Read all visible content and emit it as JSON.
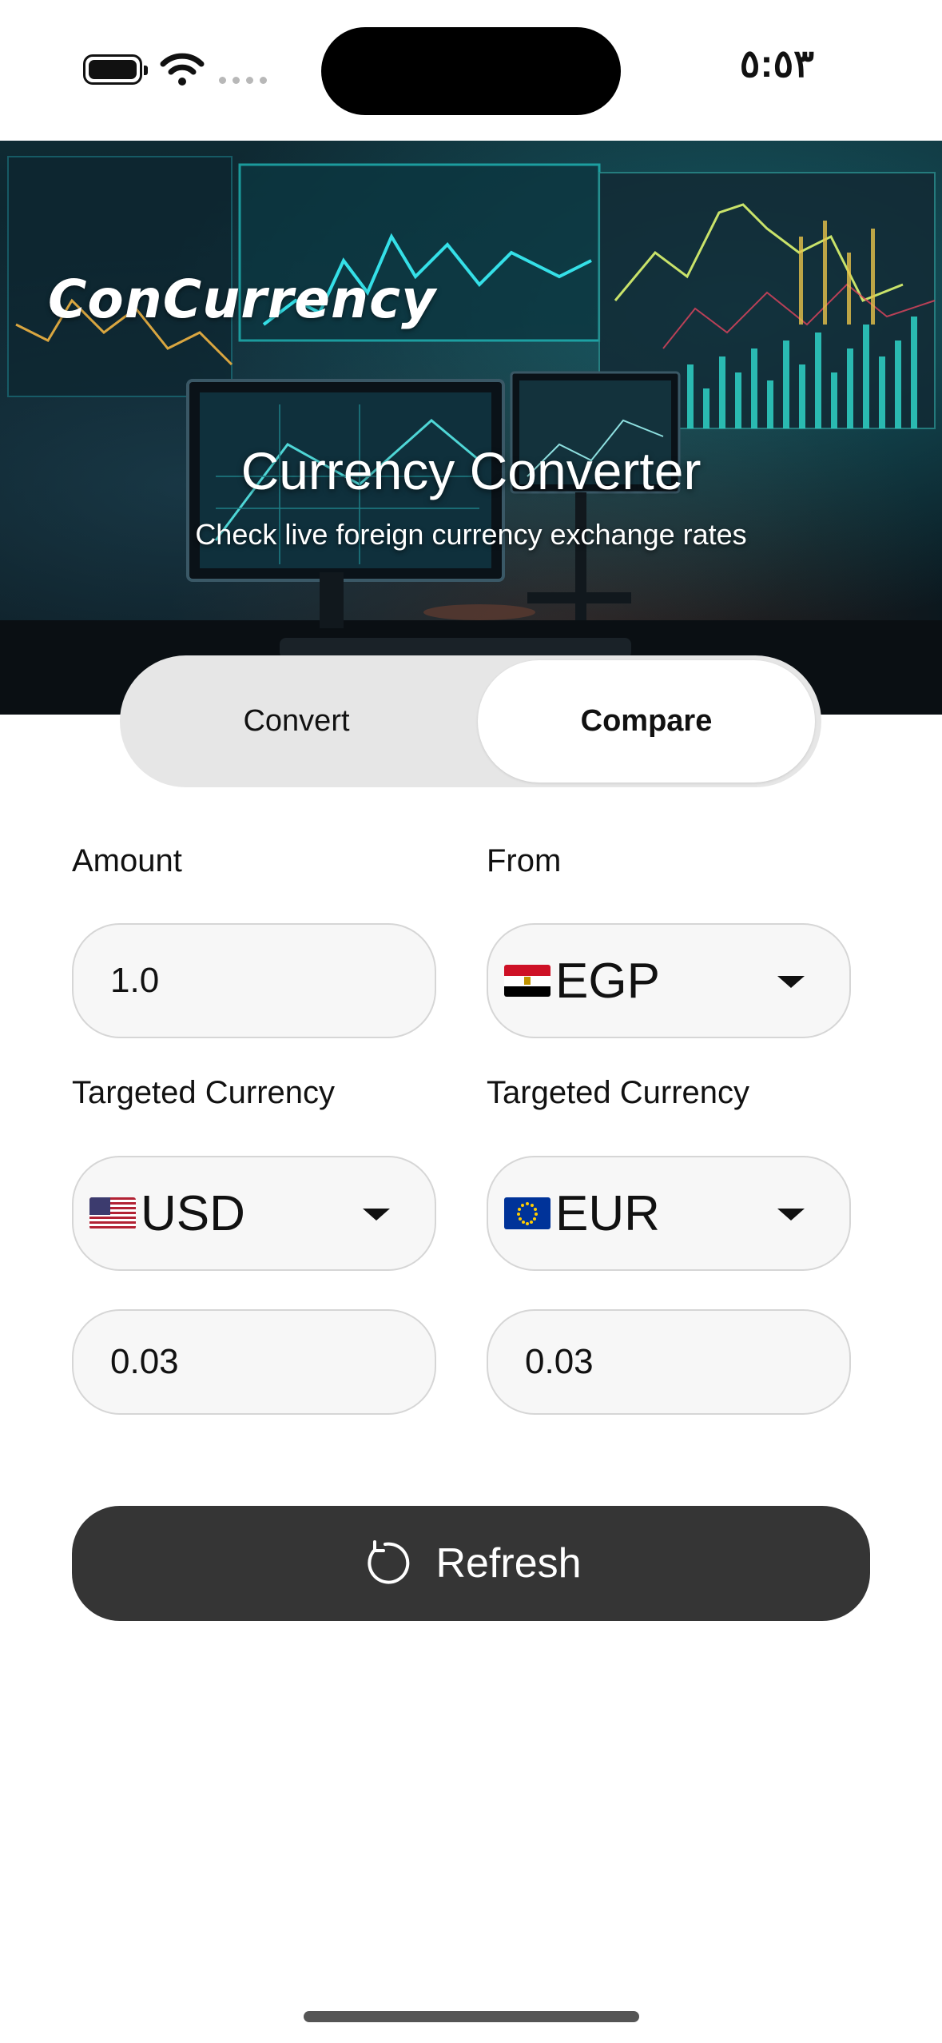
{
  "status_bar": {
    "time": "٥:٥٣"
  },
  "hero": {
    "brand": "ConCurrency",
    "title": "Currency Converter",
    "subtitle": "Check live foreign currency exchange rates"
  },
  "tabs": [
    {
      "label": "Convert",
      "selected": false
    },
    {
      "label": "Compare",
      "selected": true
    }
  ],
  "form": {
    "amount_label": "Amount",
    "amount_value": "1.0",
    "from_label": "From",
    "from_currency": "EGP",
    "target_label_1": "Targeted Currency",
    "target_label_2": "Targeted Currency",
    "target_currency_1": "USD",
    "target_currency_2": "EUR",
    "result_1": "0.03",
    "result_2": "0.03"
  },
  "actions": {
    "refresh_label": "Refresh"
  },
  "icons": {
    "from_flag": "egypt-flag-icon",
    "target_flag_1": "us-flag-icon",
    "target_flag_2": "eu-flag-icon",
    "dropdown": "caret-down-icon",
    "refresh": "refresh-icon"
  },
  "colors": {
    "segment_bg": "#e6e6e6",
    "field_bg": "#f7f7f7",
    "refresh_button": "#353535"
  }
}
